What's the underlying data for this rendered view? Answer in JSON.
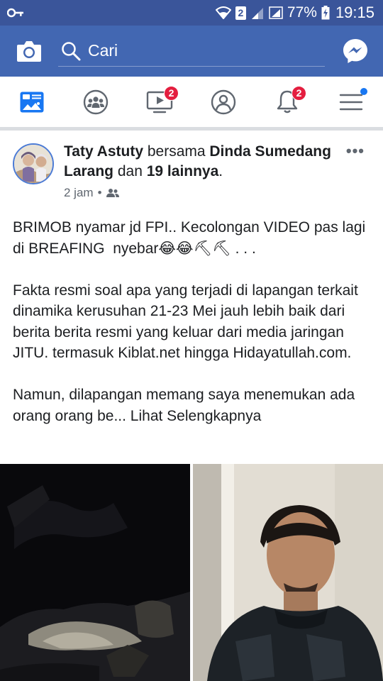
{
  "status_bar": {
    "sim_slot": "2",
    "battery": "77%",
    "time": "19:15",
    "bg_color": "#3a559a"
  },
  "search_bar": {
    "placeholder": "Cari",
    "bg_color": "#4267b2",
    "camera_icon": "camera-icon",
    "messenger_icon": "messenger-icon"
  },
  "tabs": [
    {
      "name": "news-feed",
      "icon": "news-feed-icon",
      "badge": ""
    },
    {
      "name": "groups",
      "icon": "groups-icon",
      "badge": ""
    },
    {
      "name": "watch",
      "icon": "watch-icon",
      "badge": "2"
    },
    {
      "name": "profile",
      "icon": "profile-icon",
      "badge": ""
    },
    {
      "name": "notifications",
      "icon": "bell-icon",
      "badge": "2"
    },
    {
      "name": "menu",
      "icon": "hamburger-icon",
      "badge": ""
    }
  ],
  "post": {
    "author": "Taty Astuty",
    "with_word": " bersama ",
    "tagged": "Dinda Sumedang Larang",
    "and_word": " dan ",
    "others": "19 lainnya",
    "time": "2 jam",
    "separator": "•",
    "privacy_icon": "friends-icon",
    "paragraphs": [
      "BRIMOB nyamar jd FPI.. Kecolongan VIDEO pas lagi di BREAFING  nyebar😂😂⛏⛏ . . .",
      "Fakta resmi soal apa yang terjadi di lapangan terkait dinamika kerusuhan 21-23 Mei jauh lebih baik dari berita berita resmi yang keluar dari media jaringan JITU. termasuk Kiblat.net hingga Hidayatullah.com."
    ],
    "truncated_text": "Namun, dilapangan memang saya menemukan ada orang orang be... ",
    "see_more": "Lihat Selengkapnya"
  },
  "colors": {
    "accent": "#1877f2",
    "badge": "#e41e3f",
    "text": "#1c1e21",
    "secondary_text": "#606770"
  }
}
